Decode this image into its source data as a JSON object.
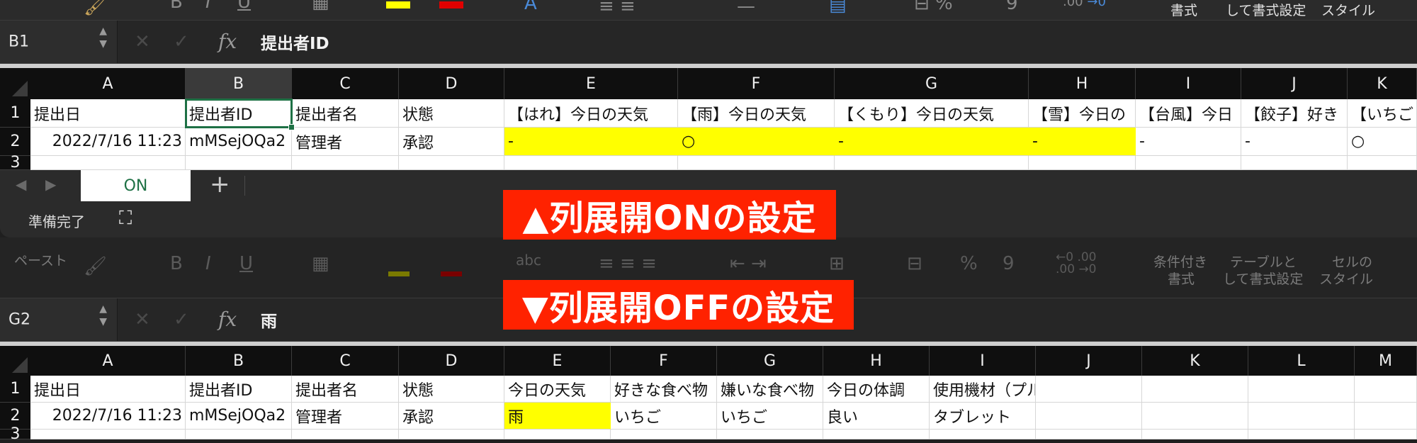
{
  "top": {
    "ribbon": {
      "labels": [
        "書式",
        "して書式設定",
        "スタイル"
      ],
      "icons": [
        "paint-brush-icon",
        "bold-icon",
        "italic-icon",
        "underline-icon",
        "border-icon",
        "fill-color-icon",
        "font-color-icon",
        "text-effects-icon",
        "align-icon",
        "merge-icon",
        "number-format-icon",
        "percent-icon",
        "comma-icon",
        "increase-decimal-icon"
      ]
    },
    "formula_bar": {
      "cell_ref": "B1",
      "fx": "fx",
      "value": "提出者ID"
    },
    "columns": [
      "A",
      "B",
      "C",
      "D",
      "E",
      "F",
      "G",
      "H",
      "I",
      "J",
      "K"
    ],
    "rows": [
      "1",
      "2",
      "3"
    ],
    "row1": [
      "提出日",
      "提出者ID",
      "提出者名",
      "状態",
      "【はれ】今日の天気",
      "【雨】今日の天気",
      "【くもり】今日の天気",
      "【雪】今日の",
      "【台風】今日",
      "【餃子】好き",
      "【いちご"
    ],
    "row2": [
      "2022/7/16 11:23",
      "mMSejOQa2",
      "管理者",
      "承認",
      "-",
      "○",
      "-",
      "-",
      "-",
      "-",
      "○"
    ],
    "sheet_tab": "ON",
    "add_sheet": "+",
    "status": "準備完了"
  },
  "banners": {
    "on": "▲列展開ONの設定",
    "off": "▼列展開OFFの設定"
  },
  "bottom": {
    "ribbon": {
      "labels": [
        "ペースト",
        "条件付き",
        "書式",
        "テーブルと",
        "して書式設定",
        "セルの",
        "スタイル"
      ],
      "icons": [
        "paste-icon",
        "bold-icon",
        "italic-icon",
        "underline-icon",
        "border-icon",
        "fill-color-icon",
        "font-color-icon",
        "text-effects-icon",
        "align-icon",
        "indent-icon",
        "merge-icon",
        "number-format-icon",
        "percent-icon",
        "comma-icon",
        "decimal-icon"
      ]
    },
    "formula_bar": {
      "cell_ref": "G2",
      "fx": "fx",
      "value": "雨"
    },
    "columns": [
      "A",
      "B",
      "C",
      "D",
      "E",
      "F",
      "G",
      "H",
      "I",
      "J",
      "K",
      "L",
      "M"
    ],
    "rows": [
      "1",
      "2",
      "3"
    ],
    "row1": [
      "提出日",
      "提出者ID",
      "提出者名",
      "状態",
      "今日の天気",
      "好きな食べ物",
      "嫌いな食べ物",
      "今日の体調",
      "使用機材（プルダウン式）",
      "",
      "",
      "",
      ""
    ],
    "row2": [
      "2022/7/16 11:23",
      "mMSejOQa2",
      "管理者",
      "承認",
      "雨",
      "いちご",
      "いちご",
      "良い",
      "タブレット",
      "",
      "",
      "",
      ""
    ]
  }
}
